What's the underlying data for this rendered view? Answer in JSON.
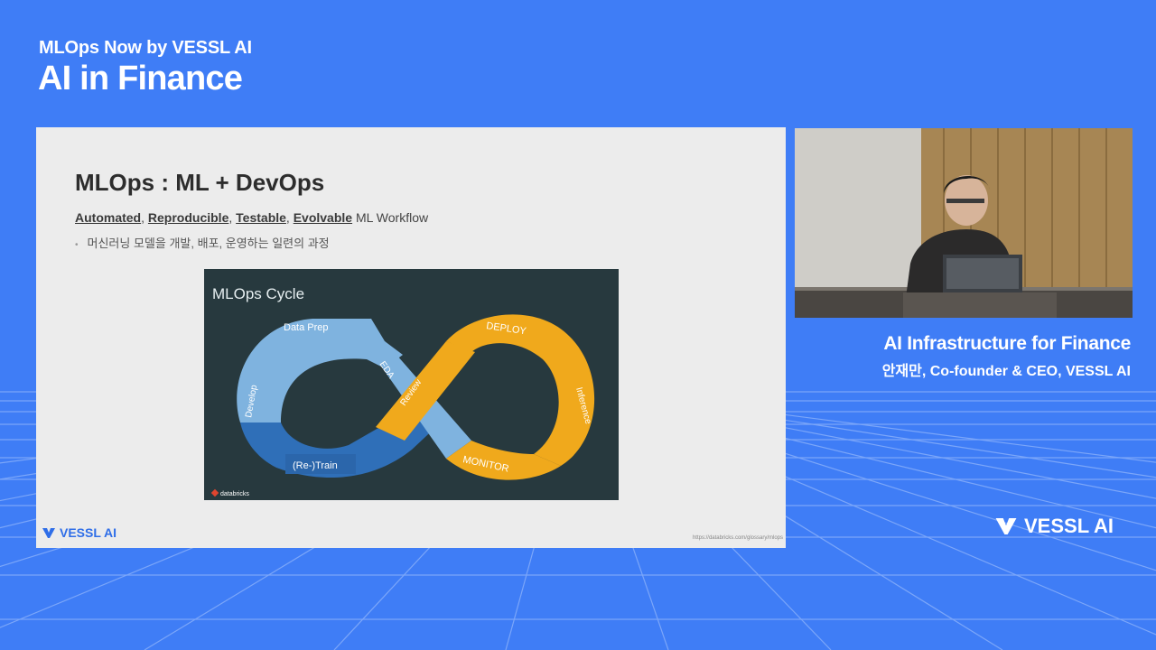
{
  "event": {
    "subtitle": "MLOps Now by VESSL AI",
    "title": "AI in Finance"
  },
  "slide": {
    "title": "MLOps : ML + DevOps",
    "keywords": [
      "Automated",
      "Reproducible",
      "Testable",
      "Evolvable"
    ],
    "separator": ",",
    "keyword_suffix": "ML Workflow",
    "bullet": "머신러닝 모델을 개발, 배포, 운영하는 일련의 과정",
    "cycle": {
      "title": "MLOps Cycle",
      "stages": {
        "data_prep": "Data Prep",
        "eda": "EDA",
        "develop": "Develop",
        "train": "(Re-)Train",
        "review": "Review",
        "deploy": "DEPLOY",
        "inference": "Inference",
        "monitor": "MONITOR"
      },
      "watermark": "databricks",
      "colors": {
        "light_blue": "#7fb3df",
        "dark_blue": "#2f6fb8",
        "orange": "#f0a91c",
        "background": "#27393e"
      }
    },
    "logo": "VESSL AI",
    "source": "https://databricks.com/glossary/mlops"
  },
  "speaker": {
    "talk_title": "AI Infrastructure for Finance",
    "name_role": "안재만, Co-founder & CEO, VESSL AI"
  },
  "brand": {
    "logo": "VESSL AI"
  },
  "colors": {
    "background": "#3f7df6",
    "slide_bg": "#ececec",
    "accent": "#2f6ee8"
  }
}
